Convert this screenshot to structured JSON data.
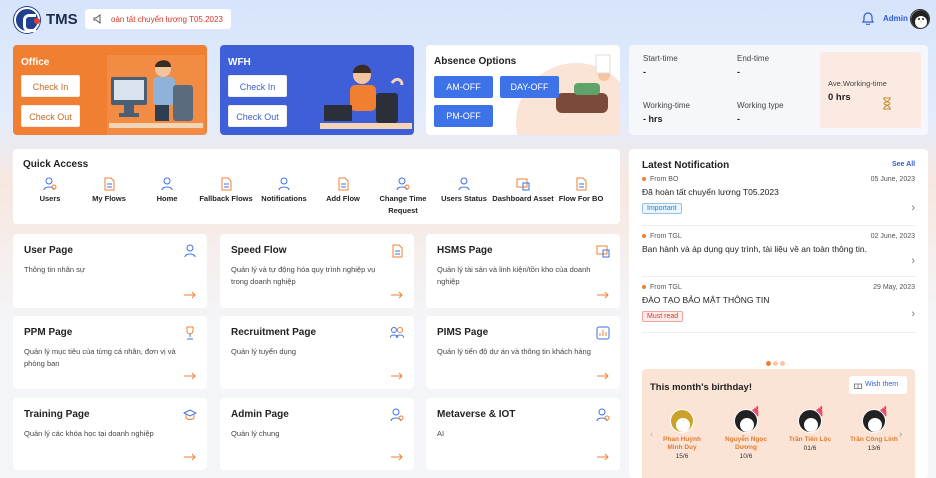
{
  "header": {
    "brand": "TMS",
    "marquee_text": "oàn tất chuyển lương T05.2023",
    "user_label": "Admin"
  },
  "office": {
    "title": "Office",
    "check_in": "Check In",
    "check_out": "Check Out"
  },
  "wfh": {
    "title": "WFH",
    "check_in": "Check In",
    "check_out": "Check Out"
  },
  "absence": {
    "title": "Absence Options",
    "am_off": "AM-OFF",
    "day_off": "DAY-OFF",
    "pm_off": "PM-OFF"
  },
  "work_info": {
    "start_label": "Start-time",
    "start_value": "-",
    "end_label": "End-time",
    "end_value": "-",
    "working_time_label": "Working-time",
    "working_time_value": "- hrs",
    "working_type_label": "Working type",
    "working_type_value": "-",
    "avg_label": "Ave.Working-time",
    "avg_value": "0 hrs"
  },
  "quick_access": {
    "title": "Quick Access",
    "items": [
      {
        "label": "Users"
      },
      {
        "label": "My Flows"
      },
      {
        "label": "Home"
      },
      {
        "label": "Fallback Flows"
      },
      {
        "label": "Notifications"
      },
      {
        "label": "Add Flow"
      },
      {
        "label": "Change Time Request"
      },
      {
        "label": "Users Status"
      },
      {
        "label": "Dashboard Asset"
      },
      {
        "label": "Flow For BO"
      }
    ]
  },
  "pages": [
    {
      "title": "User Page",
      "desc": "Thông tin nhân sự",
      "icon": "user-icon"
    },
    {
      "title": "Speed Flow",
      "desc": "Quản lý và tự động hóa quy trình nghiệp vụ trong doanh nghiệp",
      "icon": "document-icon"
    },
    {
      "title": "HSMS Page",
      "desc": "Quản lý tài sản và linh kiện/tồn kho của doanh nghiệp",
      "icon": "asset-icon"
    },
    {
      "title": "PPM Page",
      "desc": "Quản lý mục tiêu của từng cá nhân, đơn vị và phòng ban",
      "icon": "trophy-icon"
    },
    {
      "title": "Recruitment Page",
      "desc": "Quản lý tuyển dụng",
      "icon": "users-icon"
    },
    {
      "title": "PIMS Page",
      "desc": "Quản lý tiến độ dự án và thông tin khách hàng",
      "icon": "chart-icon"
    },
    {
      "title": "Training Page",
      "desc": "Quản lý các khóa học tại doanh nghiệp",
      "icon": "graduation-cap-icon"
    },
    {
      "title": "Admin Page",
      "desc": "Quản lý chung",
      "icon": "admin-user-icon"
    },
    {
      "title": "Metaverse & IOT",
      "desc": "AI",
      "icon": "admin-user-icon"
    }
  ],
  "notifications": {
    "title": "Latest Notification",
    "see_all": "See All",
    "items": [
      {
        "from": "From BO",
        "date": "05 June, 2023",
        "text": "Đã hoàn tất chuyển lương T05.2023",
        "tag": "Important"
      },
      {
        "from": "From TGL",
        "date": "02 June, 2023",
        "text": "Ban hành và áp dụng quy trình, tài liệu về an toàn thông tin.",
        "tag": ""
      },
      {
        "from": "From TGL",
        "date": "29 May, 2023",
        "text": "ĐÀO TẠO BẢO MẬT THÔNG TIN",
        "tag": "Must read"
      }
    ]
  },
  "birthday": {
    "title": "This month's birthday!",
    "wish_label": "Wish them",
    "people": [
      {
        "name": "Phan Huỳnh Minh Duy",
        "date": "15/6"
      },
      {
        "name": "Nguyễn Ngọc Dương",
        "date": "10/6"
      },
      {
        "name": "Trần Tiến Lộc",
        "date": "01/6"
      },
      {
        "name": "Trần Công Linh",
        "date": "13/6"
      }
    ]
  },
  "colors": {
    "accent": "#3d72e8",
    "office": "#f07f31",
    "wfh": "#3e5fd7",
    "brand_text": "#1c2b4a"
  }
}
